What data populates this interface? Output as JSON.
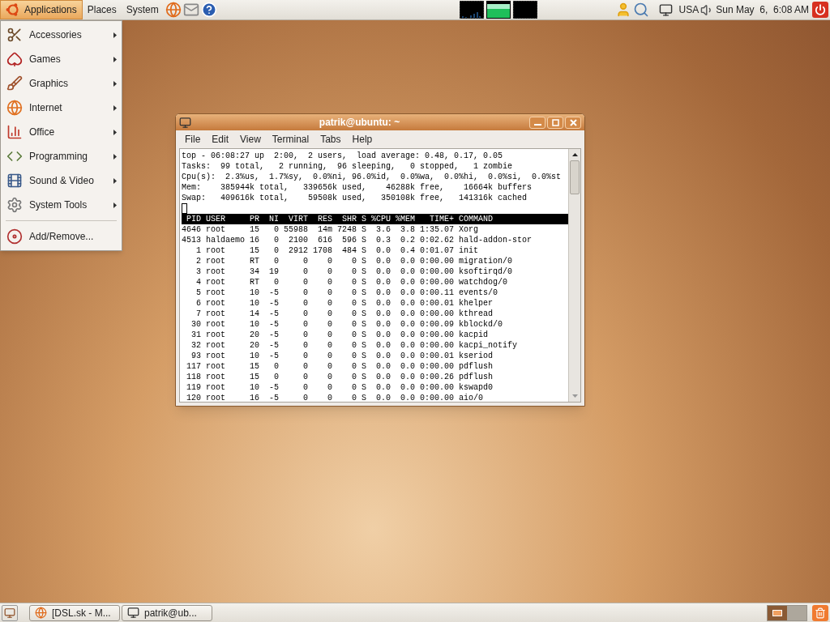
{
  "top_panel": {
    "menus": [
      {
        "label": "Applications",
        "selected": true
      },
      {
        "label": "Places",
        "selected": false
      },
      {
        "label": "System",
        "selected": false
      }
    ],
    "keyboard_layout": "USA",
    "clock": "Sun May  6,  6:08 AM"
  },
  "applications_menu": {
    "items": [
      {
        "label": "Accessories",
        "kind": "submenu"
      },
      {
        "label": "Games",
        "kind": "submenu"
      },
      {
        "label": "Graphics",
        "kind": "submenu"
      },
      {
        "label": "Internet",
        "kind": "submenu"
      },
      {
        "label": "Office",
        "kind": "submenu"
      },
      {
        "label": "Programming",
        "kind": "submenu"
      },
      {
        "label": "Sound & Video",
        "kind": "submenu"
      },
      {
        "label": "System Tools",
        "kind": "submenu"
      },
      {
        "label": "Add/Remove...",
        "kind": "action"
      }
    ]
  },
  "terminal_window": {
    "title": "patrik@ubuntu: ~",
    "menu": [
      "File",
      "Edit",
      "View",
      "Terminal",
      "Tabs",
      "Help"
    ],
    "summary": [
      "top - 06:08:27 up  2:00,  2 users,  load average: 0.48, 0.17, 0.05",
      "Tasks:  99 total,   2 running,  96 sleeping,   0 stopped,   1 zombie",
      "Cpu(s):  2.3%us,  1.7%sy,  0.0%ni, 96.0%id,  0.0%wa,  0.0%hi,  0.0%si,  0.0%st",
      "Mem:    385944k total,   339656k used,    46288k free,    16664k buffers",
      "Swap:   409616k total,    59508k used,   350108k free,   141316k cached"
    ],
    "columns": [
      "PID",
      "USER",
      "PR",
      "NI",
      "VIRT",
      "RES",
      "SHR",
      "S",
      "%CPU",
      "%MEM",
      "TIME+",
      "COMMAND"
    ],
    "rows": [
      [
        "4646",
        "root",
        "15",
        "0",
        "55988",
        "14m",
        "7248",
        "S",
        "3.6",
        "3.8",
        "1:35.07",
        "Xorg"
      ],
      [
        "4513",
        "haldaemo",
        "16",
        "0",
        "2100",
        "616",
        "596",
        "S",
        "0.3",
        "0.2",
        "0:02.62",
        "hald-addon-stor"
      ],
      [
        "1",
        "root",
        "15",
        "0",
        "2912",
        "1708",
        "484",
        "S",
        "0.0",
        "0.4",
        "0:01.07",
        "init"
      ],
      [
        "2",
        "root",
        "RT",
        "0",
        "0",
        "0",
        "0",
        "S",
        "0.0",
        "0.0",
        "0:00.00",
        "migration/0"
      ],
      [
        "3",
        "root",
        "34",
        "19",
        "0",
        "0",
        "0",
        "S",
        "0.0",
        "0.0",
        "0:00.00",
        "ksoftirqd/0"
      ],
      [
        "4",
        "root",
        "RT",
        "0",
        "0",
        "0",
        "0",
        "S",
        "0.0",
        "0.0",
        "0:00.00",
        "watchdog/0"
      ],
      [
        "5",
        "root",
        "10",
        "-5",
        "0",
        "0",
        "0",
        "S",
        "0.0",
        "0.0",
        "0:00.11",
        "events/0"
      ],
      [
        "6",
        "root",
        "10",
        "-5",
        "0",
        "0",
        "0",
        "S",
        "0.0",
        "0.0",
        "0:00.01",
        "khelper"
      ],
      [
        "7",
        "root",
        "14",
        "-5",
        "0",
        "0",
        "0",
        "S",
        "0.0",
        "0.0",
        "0:00.00",
        "kthread"
      ],
      [
        "30",
        "root",
        "10",
        "-5",
        "0",
        "0",
        "0",
        "S",
        "0.0",
        "0.0",
        "0:00.09",
        "kblockd/0"
      ],
      [
        "31",
        "root",
        "20",
        "-5",
        "0",
        "0",
        "0",
        "S",
        "0.0",
        "0.0",
        "0:00.00",
        "kacpid"
      ],
      [
        "32",
        "root",
        "20",
        "-5",
        "0",
        "0",
        "0",
        "S",
        "0.0",
        "0.0",
        "0:00.00",
        "kacpi_notify"
      ],
      [
        "93",
        "root",
        "10",
        "-5",
        "0",
        "0",
        "0",
        "S",
        "0.0",
        "0.0",
        "0:00.01",
        "kseriod"
      ],
      [
        "117",
        "root",
        "15",
        "0",
        "0",
        "0",
        "0",
        "S",
        "0.0",
        "0.0",
        "0:00.00",
        "pdflush"
      ],
      [
        "118",
        "root",
        "15",
        "0",
        "0",
        "0",
        "0",
        "S",
        "0.0",
        "0.0",
        "0:00.26",
        "pdflush"
      ],
      [
        "119",
        "root",
        "10",
        "-5",
        "0",
        "0",
        "0",
        "S",
        "0.0",
        "0.0",
        "0:00.00",
        "kswapd0"
      ],
      [
        "120",
        "root",
        "16",
        "-5",
        "0",
        "0",
        "0",
        "S",
        "0.0",
        "0.0",
        "0:00.00",
        "aio/0"
      ]
    ]
  },
  "bottom_panel": {
    "tasks": [
      {
        "label": "[DSL.sk - M...",
        "selected": false,
        "kind": "browser"
      },
      {
        "label": "patrik@ub...",
        "selected": false,
        "kind": "terminal"
      }
    ],
    "workspaces": [
      {
        "selected": true
      },
      {
        "selected": false
      }
    ]
  }
}
